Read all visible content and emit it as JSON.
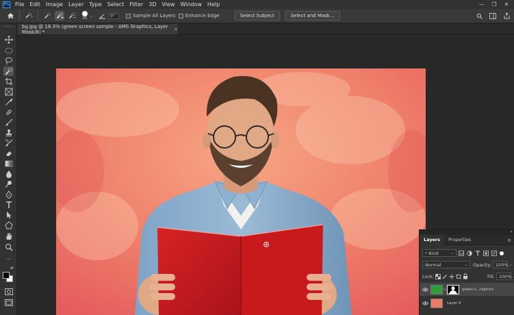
{
  "app": {
    "logo": "Ps"
  },
  "menu": [
    "File",
    "Edit",
    "Image",
    "Layer",
    "Type",
    "Select",
    "Filter",
    "3D",
    "View",
    "Window",
    "Help"
  ],
  "options": {
    "brush_size": "65",
    "angle_value": "0°",
    "sample_all_layers": "Sample All Layers",
    "enhance_edge": "Enhance Edge",
    "select_subject": "Select Subject",
    "select_and_mask": "Select and Mask..."
  },
  "document": {
    "tab_title": "bg.jpg @ 18.3% (green screen sample - AMS Graphics, Layer Mask/8) *",
    "close": "×"
  },
  "layers_panel": {
    "tabs": [
      "Layers",
      "Properties"
    ],
    "filter_kind": "Kind",
    "blend_mode": "Normal",
    "opacity_label": "Opacity:",
    "opacity_value": "100%",
    "lock_label": "Lock:",
    "fill_label": "Fill:",
    "fill_value": "100%",
    "layers": [
      {
        "name": "green s...raphics",
        "selected": true
      },
      {
        "name": "Layer 0",
        "selected": false
      }
    ]
  },
  "colors": {
    "accent": "#31a8ff",
    "panel_bg": "#323232",
    "canvas_bg": "#282828",
    "book_red": "#c8191c"
  }
}
